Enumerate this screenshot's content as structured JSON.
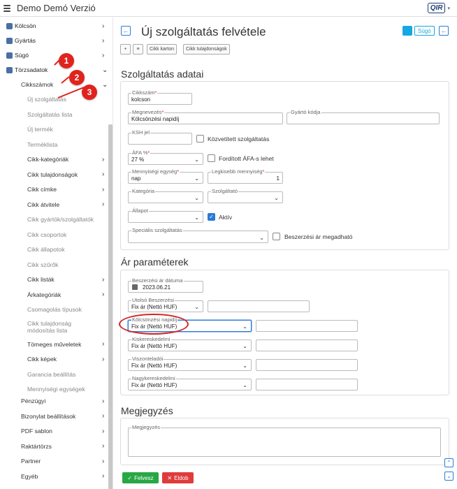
{
  "app": {
    "title": "Demo Demó Verzió",
    "logo_text": "QIR",
    "logo_caret": "▾"
  },
  "sidebar": {
    "top_items": [
      {
        "label": "Kölcsön",
        "icon": "anchor-icon",
        "chevron": "›"
      },
      {
        "label": "Gyártás",
        "icon": "cogs-icon",
        "chevron": "›"
      },
      {
        "label": "Súgó",
        "icon": "question-icon",
        "chevron": "›"
      },
      {
        "label": "Törzsadatok",
        "icon": "database-icon",
        "chevron": "⌄"
      }
    ],
    "cikkszamok": {
      "label": "Cikkszámok",
      "chevron": "⌄"
    },
    "sub_items": [
      {
        "label": "Új szolgáltatás",
        "chevron": ""
      },
      {
        "label": "Szolgáltatás lista",
        "chevron": ""
      },
      {
        "label": "Új termék",
        "chevron": ""
      },
      {
        "label": "Terméklista",
        "chevron": ""
      },
      {
        "label": "Cikk-kategóriák",
        "chevron": "›"
      },
      {
        "label": "Cikk tulajdonságok",
        "chevron": "›"
      },
      {
        "label": "Cikk címke",
        "chevron": "›"
      },
      {
        "label": "Cikk átvitele",
        "chevron": "›"
      },
      {
        "label": "Cikk gyártók/szolgáltatók",
        "chevron": ""
      },
      {
        "label": "Cikk csoportok",
        "chevron": ""
      },
      {
        "label": "Cikk állapotok",
        "chevron": ""
      },
      {
        "label": "Cikk szűrők",
        "chevron": ""
      },
      {
        "label": "Cikk listák",
        "chevron": "›"
      },
      {
        "label": "Árkategóriák",
        "chevron": "›"
      },
      {
        "label": "Csomagolás típusok",
        "chevron": ""
      },
      {
        "label": "Cikk tulajdonság",
        "label2": "módosítás lista",
        "chevron": ""
      },
      {
        "label": "Tömeges műveletek",
        "chevron": "›"
      },
      {
        "label": "Cikk képek",
        "chevron": "›"
      },
      {
        "label": "Garancia beállítás",
        "chevron": ""
      },
      {
        "label": "Mennyiségi egységek",
        "chevron": ""
      }
    ],
    "bottom_items": [
      {
        "label": "Pénzügyi",
        "chevron": "›"
      },
      {
        "label": "Bizonylat beállítások",
        "chevron": "›"
      },
      {
        "label": "PDF sablon",
        "chevron": "›"
      },
      {
        "label": "Raktártörzs",
        "chevron": "›"
      },
      {
        "label": "Partner",
        "chevron": "›"
      },
      {
        "label": "Egyéb",
        "chevron": "›"
      },
      {
        "label": "Szöveg sablon",
        "chevron": "›"
      }
    ]
  },
  "annotations": {
    "badge1": "1",
    "badge2": "2",
    "badge3": "3"
  },
  "header": {
    "back_icon": "←",
    "title": "Új szolgáltatás felvétele",
    "help_label": "Súgó",
    "back_right_icon": "←"
  },
  "toolbar": {
    "add_icon": "+",
    "list_icon": "≡",
    "btn1": "Cikk karton",
    "btn2": "Cikk tulajdonságok"
  },
  "service": {
    "section_title": "Szolgáltatás adatai",
    "cikkszam_label": "Cikkszám",
    "cikkszam_value": "kolcson",
    "megnevezes_label": "Megnevezés",
    "megnevezes_value": "Kölcsönzési napidíj",
    "gyarto_label": "Gyártó kódja",
    "gyarto_value": "",
    "ksh_label": "KSH jel",
    "ksh_value": "",
    "kozvetitett_label": "Közvetített szolgáltatás",
    "afa_label": "ÁFA %",
    "afa_value": "27 %",
    "forditott_label": "Fordított ÁFA-s lehet",
    "mennyisegi_label": "Mennyiségi egység",
    "mennyisegi_value": "nap",
    "legkisebb_label": "Legkisebb mennyiség",
    "legkisebb_value": "1",
    "kategoria_label": "Kategória",
    "kategoria_value": "",
    "szolgaltato_label": "Szolgáltató",
    "szolgaltato_value": "",
    "allapot_label": "Állapot",
    "allapot_value": "",
    "aktiv_label": "Aktív",
    "specialis_label": "Speciális szolgáltatás",
    "specialis_value": "",
    "beszerzesi_ar_label": "Beszerzési ár megadható",
    "required_mark": "*",
    "chevron": "⌄"
  },
  "prices": {
    "section_title": "Ár paraméterek",
    "beszerzesi_datum_label": "Beszerzési ár dátuma",
    "beszerzesi_datum_value": "2023.06.21",
    "rows": [
      {
        "label": "Utolsó Beszerzési",
        "value": "Fix ár (Nettó HUF)"
      },
      {
        "label": "Kölcsönzési napidíj",
        "value": "Fix ár (Nettó HUF)"
      },
      {
        "label": "Kiskereskedelmi",
        "value": "Fix ár (Nettó HUF)"
      },
      {
        "label": "Viszonteladói",
        "value": "Fix ár (Nettó HUF)"
      },
      {
        "label": "Nagykereskedelmi",
        "value": "Fix ár (Nettó HUF)"
      }
    ]
  },
  "notes": {
    "section_title": "Megjegyzés",
    "field_label": "Megjegyzés"
  },
  "actions": {
    "save_label": "Felvesz",
    "delete_label": "Eldob",
    "save_icon": "✓",
    "delete_icon": "✕",
    "up_icon": "⌃",
    "down_icon": "⌄"
  },
  "colors": {
    "accent": "#2a7ad8",
    "info": "#16a8e0",
    "save": "#28a745",
    "delete": "#e03b3b",
    "annotation": "#e0231d"
  }
}
